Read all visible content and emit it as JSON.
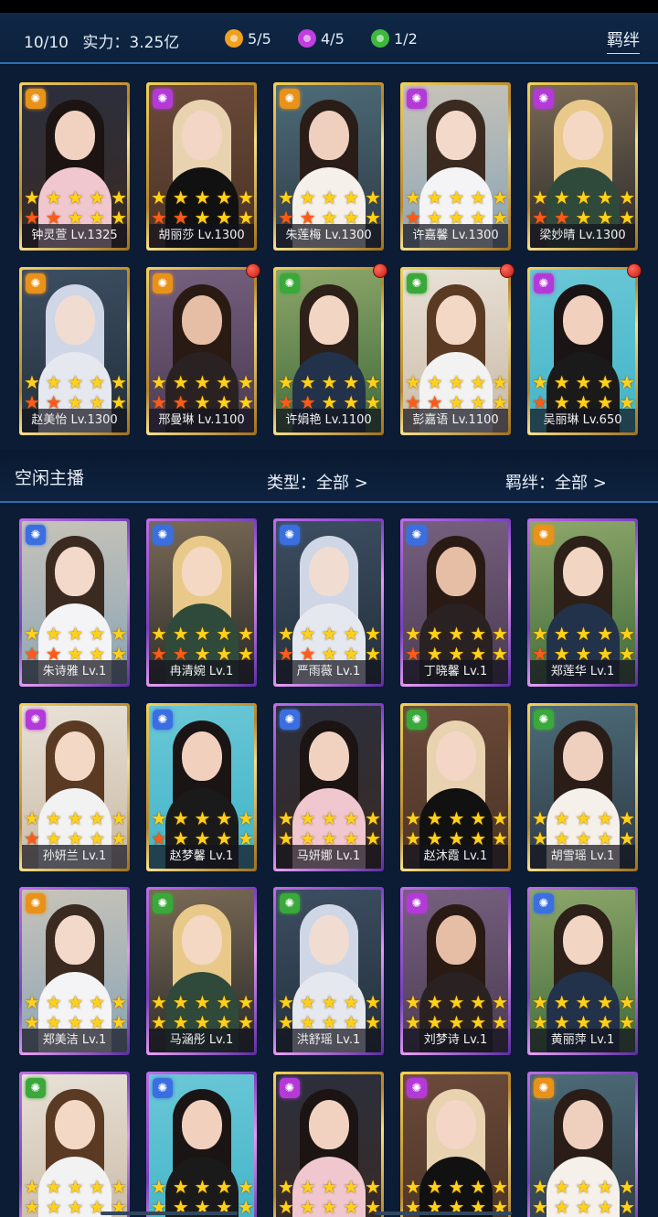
{
  "header": {
    "count": "10/10",
    "power": "实力：3.25亿",
    "stats": [
      {
        "icon": "orange-faction-icon",
        "color": "#f0a020",
        "value": "5/5"
      },
      {
        "icon": "purple-faction-icon",
        "color": "#c03ee0",
        "value": "4/5"
      },
      {
        "icon": "green-faction-icon",
        "color": "#3fb83f",
        "value": "1/2"
      }
    ],
    "bond_button": "羁绊"
  },
  "divider": {
    "title": "空闲主播",
    "type_filter": "类型：全部  >",
    "bond_filter": "羁绊：全部  >"
  },
  "team": [
    {
      "name": "钟灵萱 Lv.1325",
      "faction": "orange",
      "frame": "gold",
      "red_stars": 2,
      "badge": false
    },
    {
      "name": "胡丽莎 Lv.1300",
      "faction": "purple",
      "frame": "gold",
      "red_stars": 2,
      "badge": false
    },
    {
      "name": "朱莲梅 Lv.1300",
      "faction": "orange",
      "frame": "gold",
      "red_stars": 2,
      "badge": false
    },
    {
      "name": "许嘉馨 Lv.1300",
      "faction": "purple",
      "frame": "gold",
      "red_stars": 1,
      "badge": false
    },
    {
      "name": "梁妙晴 Lv.1300",
      "faction": "purple",
      "frame": "gold",
      "red_stars": 2,
      "badge": false
    },
    {
      "name": "赵美怡 Lv.1300",
      "faction": "orange",
      "frame": "gold",
      "red_stars": 2,
      "badge": false
    },
    {
      "name": "邢曼琳 Lv.1100",
      "faction": "orange",
      "frame": "gold",
      "red_stars": 2,
      "badge": true
    },
    {
      "name": "许娟艳 Lv.1100",
      "faction": "green",
      "frame": "gold",
      "red_stars": 2,
      "badge": true
    },
    {
      "name": "彭嘉语 Lv.1100",
      "faction": "green",
      "frame": "gold",
      "red_stars": 2,
      "badge": true
    },
    {
      "name": "吴丽琳 Lv.650",
      "faction": "purple",
      "frame": "gold",
      "red_stars": 1,
      "badge": true
    }
  ],
  "pool": [
    {
      "name": "朱诗雅 Lv.1",
      "faction": "blue",
      "frame": "purple",
      "red_stars": 2
    },
    {
      "name": "冉清婉 Lv.1",
      "faction": "blue",
      "frame": "purple",
      "red_stars": 2
    },
    {
      "name": "严雨薇 Lv.1",
      "faction": "blue",
      "frame": "purple",
      "red_stars": 2
    },
    {
      "name": "丁晓馨 Lv.1",
      "faction": "blue",
      "frame": "purple",
      "red_stars": 1
    },
    {
      "name": "郑莲华 Lv.1",
      "faction": "orange",
      "frame": "purple",
      "red_stars": 1
    },
    {
      "name": "孙妍兰 Lv.1",
      "faction": "purple",
      "frame": "gold",
      "red_stars": 1
    },
    {
      "name": "赵梦馨 Lv.1",
      "faction": "blue",
      "frame": "gold",
      "red_stars": 1
    },
    {
      "name": "马妍娜 Lv.1",
      "faction": "blue",
      "frame": "purple",
      "red_stars": 0
    },
    {
      "name": "赵沐霞 Lv.1",
      "faction": "green",
      "frame": "gold",
      "red_stars": 0
    },
    {
      "name": "胡雪瑶 Lv.1",
      "faction": "green",
      "frame": "gold",
      "red_stars": 0
    },
    {
      "name": "郑美洁 Lv.1",
      "faction": "orange",
      "frame": "purple",
      "red_stars": 0
    },
    {
      "name": "马涵彤 Lv.1",
      "faction": "green",
      "frame": "purple",
      "red_stars": 0
    },
    {
      "name": "洪舒瑶 Lv.1",
      "faction": "green",
      "frame": "purple",
      "red_stars": 0
    },
    {
      "name": "刘梦诗 Lv.1",
      "faction": "purple",
      "frame": "purple",
      "red_stars": 0
    },
    {
      "name": "黄丽萍 Lv.1",
      "faction": "blue",
      "frame": "purple",
      "red_stars": 0
    },
    {
      "name": "",
      "faction": "green",
      "frame": "purple",
      "red_stars": 0
    },
    {
      "name": "",
      "faction": "blue",
      "frame": "purple",
      "red_stars": 0
    },
    {
      "name": "",
      "faction": "purple",
      "frame": "gold",
      "red_stars": 0
    },
    {
      "name": "",
      "faction": "purple",
      "frame": "gold",
      "red_stars": 0
    },
    {
      "name": "",
      "faction": "orange",
      "frame": "purple",
      "red_stars": 0
    }
  ],
  "faction_colors": {
    "orange": "#e8921a",
    "purple": "#b43ad8",
    "green": "#3aa83a",
    "blue": "#3b6fe0"
  }
}
